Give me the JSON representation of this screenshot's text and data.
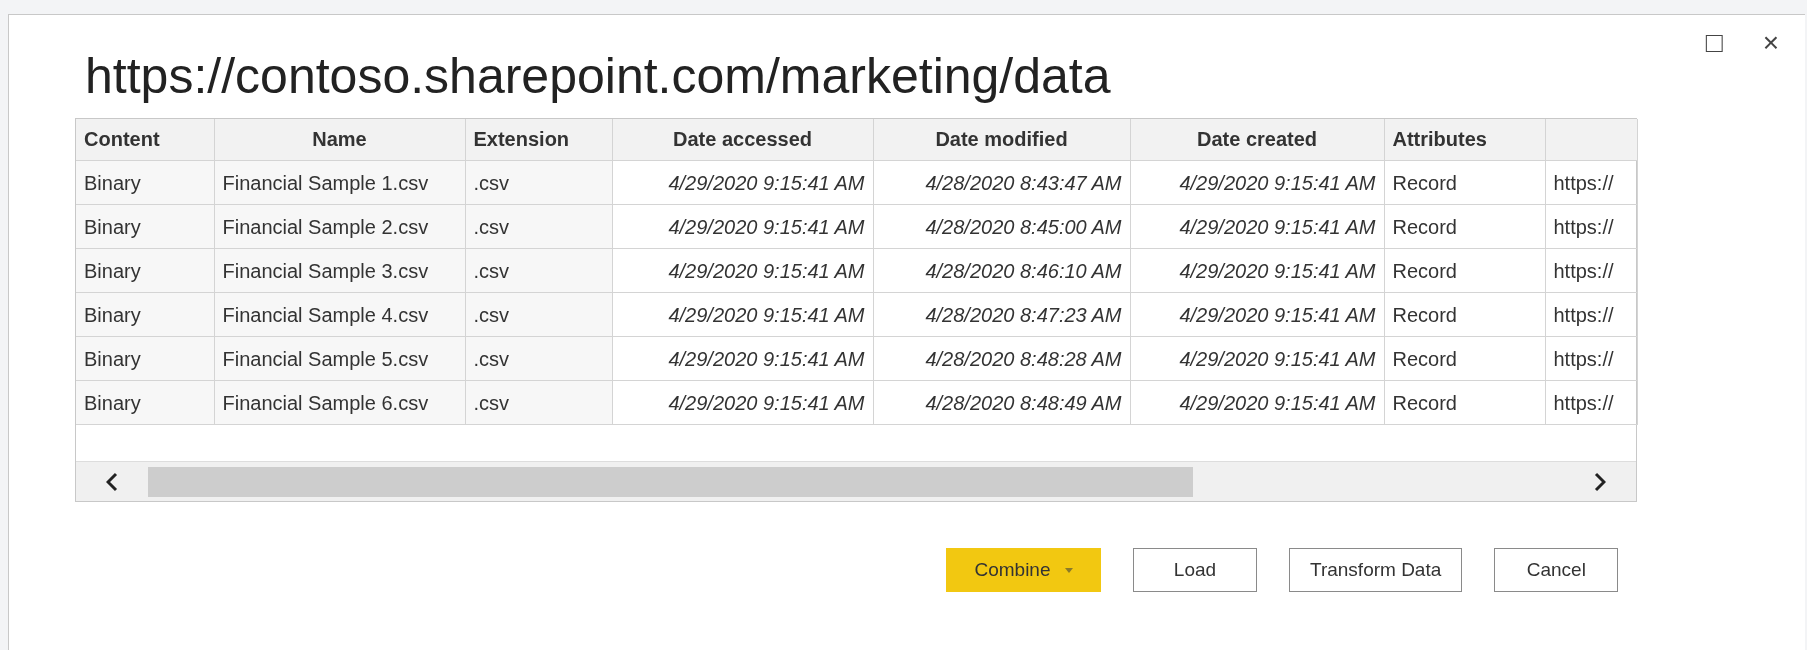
{
  "window": {
    "title": "https://contoso.sharepoint.com/marketing/data",
    "controls": [
      "□",
      "×"
    ]
  },
  "table": {
    "columns": [
      "Content",
      "Name",
      "Extension",
      "Date accessed",
      "Date modified",
      "Date created",
      "Attributes"
    ],
    "rows": [
      [
        "Binary",
        "Financial Sample 1.csv",
        ".csv",
        "4/29/2020 9:15:41 AM",
        "4/28/2020 8:43:47 AM",
        "4/29/2020 9:15:41 AM",
        "Record",
        "https://"
      ],
      [
        "Binary",
        "Financial Sample 2.csv",
        ".csv",
        "4/29/2020 9:15:41 AM",
        "4/28/2020 8:45:00 AM",
        "4/29/2020 9:15:41 AM",
        "Record",
        "https://"
      ],
      [
        "Binary",
        "Financial Sample 3.csv",
        ".csv",
        "4/29/2020 9:15:41 AM",
        "4/28/2020 8:46:10 AM",
        "4/29/2020 9:15:41 AM",
        "Record",
        "https://"
      ],
      [
        "Binary",
        "Financial Sample 4.csv",
        ".csv",
        "4/29/2020 9:15:41 AM",
        "4/28/2020 8:47:23 AM",
        "4/29/2020 9:15:41 AM",
        "Record",
        "https://"
      ],
      [
        "Binary",
        "Financial Sample 5.csv",
        ".csv",
        "4/29/2020 9:15:41 AM",
        "4/28/2020 8:48:28 AM",
        "4/29/2020 9:15:41 AM",
        "Record",
        "https://"
      ],
      [
        "Binary",
        "Financial Sample 6.csv",
        ".csv",
        "4/29/2020 9:15:41 AM",
        "4/28/2020 8:48:49 AM",
        "4/29/2020 9:15:41 AM",
        "Record",
        "https://"
      ]
    ]
  },
  "buttons": [
    {
      "label": "Combine",
      "kind": "primary"
    },
    {
      "label": "Load",
      "kind": "normal"
    },
    {
      "label": "Transform Data",
      "kind": "normal"
    },
    {
      "label": "Cancel",
      "kind": "normal"
    }
  ]
}
